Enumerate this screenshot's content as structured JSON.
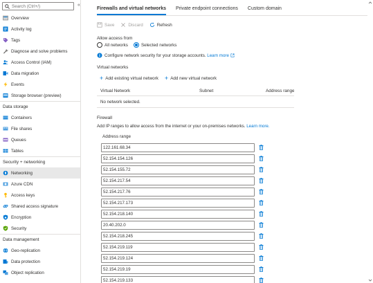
{
  "sidebar": {
    "search_placeholder": "Search (Ctrl+/)",
    "collapse_glyph": "«",
    "items_top": [
      {
        "label": "Overview",
        "icon": "overview-icon"
      },
      {
        "label": "Activity log",
        "icon": "activity-log-icon"
      },
      {
        "label": "Tags",
        "icon": "tag-icon"
      },
      {
        "label": "Diagnose and solve problems",
        "icon": "wrench-icon"
      },
      {
        "label": "Access Control (IAM)",
        "icon": "people-icon"
      },
      {
        "label": "Data migration",
        "icon": "migration-icon"
      },
      {
        "label": "Events",
        "icon": "lightning-icon"
      },
      {
        "label": "Storage browser (preview)",
        "icon": "storage-browser-icon"
      }
    ],
    "section_data_storage": "Data storage",
    "items_data_storage": [
      {
        "label": "Containers",
        "icon": "container-icon"
      },
      {
        "label": "File shares",
        "icon": "file-share-icon"
      },
      {
        "label": "Queues",
        "icon": "queue-icon"
      },
      {
        "label": "Tables",
        "icon": "table-icon"
      }
    ],
    "section_security": "Security + networking",
    "items_security": [
      {
        "label": "Networking",
        "icon": "networking-icon"
      },
      {
        "label": "Azure CDN",
        "icon": "cdn-icon"
      },
      {
        "label": "Access keys",
        "icon": "key-icon"
      },
      {
        "label": "Shared access signature",
        "icon": "link-chain-icon"
      },
      {
        "label": "Encryption",
        "icon": "lock-icon"
      },
      {
        "label": "Security",
        "icon": "shield-icon"
      }
    ],
    "section_data_management": "Data management",
    "items_data_management": [
      {
        "label": "Geo-replication",
        "icon": "globe-icon"
      },
      {
        "label": "Data protection",
        "icon": "data-protection-icon"
      },
      {
        "label": "Object replication",
        "icon": "object-replication-icon"
      }
    ]
  },
  "tabs": [
    {
      "label": "Firewalls and virtual networks"
    },
    {
      "label": "Private endpoint connections"
    },
    {
      "label": "Custom domain"
    }
  ],
  "toolbar": {
    "save": "Save",
    "discard": "Discard",
    "refresh": "Refresh"
  },
  "access": {
    "label": "Allow access from",
    "opt_all": "All networks",
    "opt_selected": "Selected networks",
    "selected_value": "Selected networks",
    "info_text": "Configure network security for your storage accounts.",
    "learn_more": "Learn more"
  },
  "vnet": {
    "title": "Virtual networks",
    "add_existing": "Add existing virtual network",
    "add_new": "Add new virtual network",
    "col_vnet": "Virtual Network",
    "col_subnet": "Subnet",
    "col_range": "Address range",
    "empty": "No network selected."
  },
  "firewall": {
    "title": "Firewall",
    "desc": "Add IP ranges to allow access from the internet or your on-premises networks.",
    "learn_more": "Learn more.",
    "col_range": "Address range",
    "ranges": [
      "122.161.68.34",
      "52.154.154.126",
      "52.154.155.72",
      "52.154.217.54",
      "52.154.217.76",
      "52.154.217.173",
      "52.154.218.140",
      "20.40.202.0",
      "52.154.218.245",
      "52.154.219.119",
      "52.154.219.124",
      "52.154.219.19",
      "52.154.219.133"
    ]
  },
  "colors": {
    "accent": "#0078d4",
    "selected_bg": "#e8e8e8",
    "border": "#e1dfdd"
  }
}
